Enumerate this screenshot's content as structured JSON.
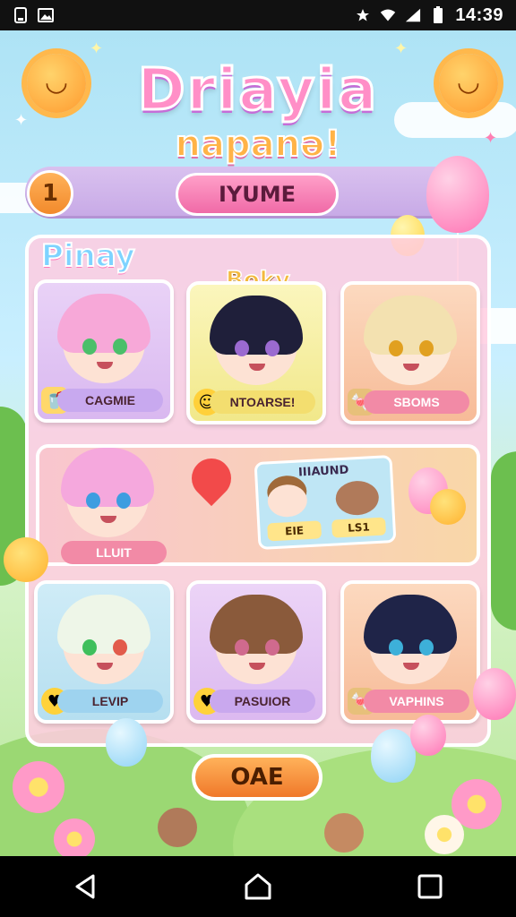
{
  "status_bar": {
    "time": "14:39",
    "left_icons": [
      "phone-screen-icon",
      "image-icon"
    ],
    "right_icons": [
      "star-icon",
      "wifi-icon",
      "signal-icon",
      "battery-icon"
    ]
  },
  "game": {
    "title": "Driayia",
    "subtitle": "napanə!",
    "level": "1",
    "header_button": "IYUME",
    "section_left_label": "Pinay",
    "section_center_label": "Boky",
    "inner_card": {
      "title": "IIIAUND",
      "left_label": "EIE",
      "right_label": "LS1"
    },
    "characters": [
      {
        "name": "CAGMIE",
        "hair": "#f7a8d8",
        "eyes": "#4bbf6a",
        "card": "#e4c6f3",
        "pill": "#c8a9ef"
      },
      {
        "name": "NTOARSE!",
        "hair": "#1f1f3a",
        "eyes": "#9b6ad0",
        "card": "#f3ee9b",
        "pill": "#f3de6f"
      },
      {
        "name": "SBOMS",
        "hair": "#f3e1b0",
        "eyes": "#e1a020",
        "card": "#f9c8a6",
        "pill": "#f28aa6"
      },
      {
        "name": "LLUIT",
        "hair": "#f5a8dd",
        "eyes": "#3d9de0",
        "card": "transparent",
        "pill": "#f28aa6"
      },
      {
        "name": "LEVIP",
        "hair": "#eef6e8",
        "eyes": "#3fbf5c",
        "card": "#c7e6f3",
        "pill": "#9ed3ef"
      },
      {
        "name": "PASUIOR",
        "hair": "#8a5a3b",
        "eyes": "#d06a8e",
        "card": "#e6c7f3",
        "pill": "#c9a8ee"
      },
      {
        "name": "VAPHINS",
        "hair": "#1f2448",
        "eyes": "#3db0d9",
        "card": "#f9caa6",
        "pill": "#f28aa6"
      }
    ],
    "bottom_button": "OAE"
  },
  "nav": {
    "icons": [
      "back-triangle-icon",
      "home-icon",
      "recents-square-icon"
    ]
  }
}
